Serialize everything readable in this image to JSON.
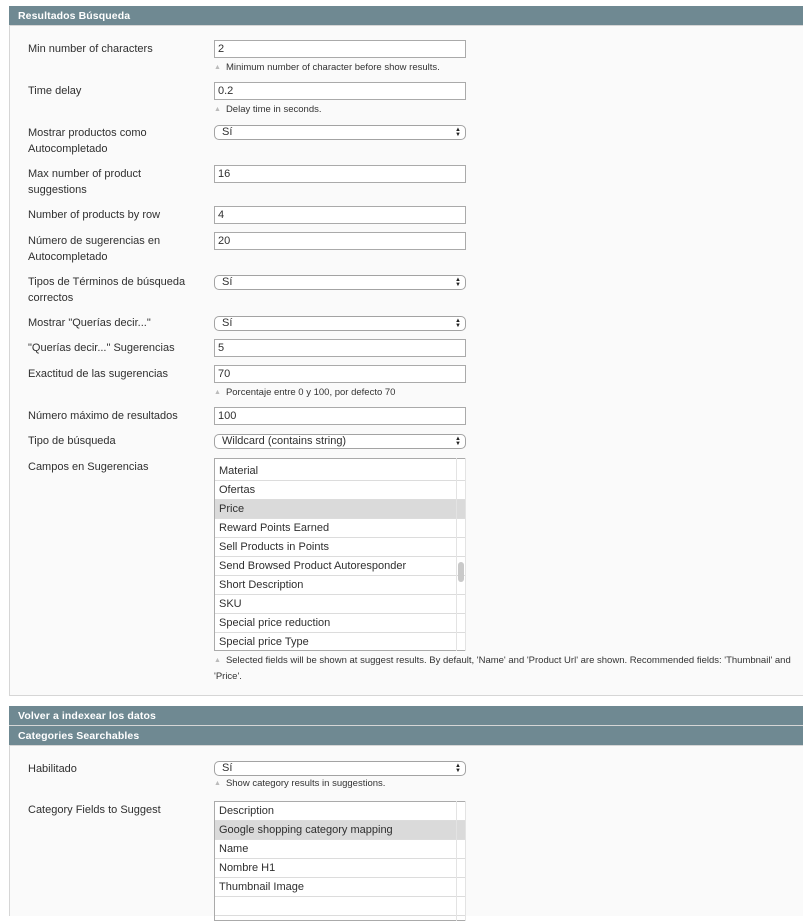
{
  "sections": {
    "resultados": {
      "title": "Resultados Búsqueda"
    },
    "reindex": {
      "title": "Volver a indexear los datos"
    },
    "categories": {
      "title": "Categories Searchables"
    }
  },
  "fields": {
    "min_chars": {
      "label": "Min number of characters",
      "value": "2",
      "note": "Minimum number of character before show results."
    },
    "time_delay": {
      "label": "Time delay",
      "value": "0.2",
      "note": "Delay time in seconds."
    },
    "show_products": {
      "label": "Mostrar productos como Autocompletado",
      "value": "Sí"
    },
    "max_product_suggestions": {
      "label": "Max number of product suggestions",
      "value": "16"
    },
    "products_by_row": {
      "label": "Number of products by row",
      "value": "4"
    },
    "num_suggestions": {
      "label": "Número de sugerencias en Autocompletado",
      "value": "20"
    },
    "correct_terms": {
      "label": "Tipos de Términos de búsqueda correctos",
      "value": "Sí"
    },
    "show_did_you_mean": {
      "label": "Mostrar \"Querías decir...\"",
      "value": "Sí"
    },
    "did_you_mean_suggestions": {
      "label": "\"Querías decir...\" Sugerencias",
      "value": "5"
    },
    "accuracy": {
      "label": "Exactitud de las sugerencias",
      "value": "70",
      "note": "Porcentaje entre 0 y 100, por defecto 70"
    },
    "max_results": {
      "label": "Número máximo de resultados",
      "value": "100"
    },
    "search_type": {
      "label": "Tipo de búsqueda",
      "value": "Wildcard (contains string)"
    },
    "suggest_fields": {
      "label": "Campos en Sugerencias",
      "options": [
        "Material",
        "Ofertas",
        "Price",
        "Reward Points Earned",
        "Sell Products in Points",
        "Send Browsed Product Autoresponder",
        "Short Description",
        "SKU",
        "Special price reduction",
        "Special price Type"
      ],
      "selected": [
        "Price"
      ],
      "note": "Selected fields will be shown at suggest results. By default, 'Name' and 'Product Url' are shown. Recommended fields: 'Thumbnail' and 'Price'."
    },
    "cat_enabled": {
      "label": "Habilitado",
      "value": "Sí",
      "note": "Show category results in suggestions."
    },
    "cat_fields": {
      "label": "Category Fields to Suggest",
      "options": [
        "Description",
        "Google shopping category mapping",
        "Name",
        "Nombre H1",
        "Thumbnail Image",
        ""
      ],
      "selected": [
        "Google shopping category mapping"
      ]
    }
  }
}
